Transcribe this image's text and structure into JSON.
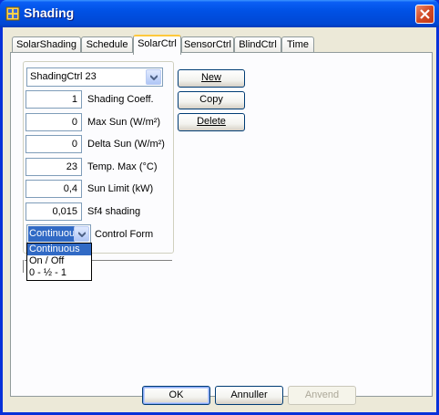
{
  "window": {
    "title": "Shading"
  },
  "tabs": [
    {
      "label": "SolarShading"
    },
    {
      "label": "Schedule"
    },
    {
      "label": "SolarCtrl"
    },
    {
      "label": "SensorCtrl"
    },
    {
      "label": "BlindCtrl"
    },
    {
      "label": "Time"
    }
  ],
  "active_tab": "SolarCtrl",
  "shading_ctrl_select": {
    "value": "ShadingCtrl 23"
  },
  "fields": [
    {
      "value": "1",
      "label": "Shading Coeff."
    },
    {
      "value": "0",
      "label": "Max Sun (W/m²)"
    },
    {
      "value": "0",
      "label": "Delta Sun (W/m²)"
    },
    {
      "value": "23",
      "label": "Temp. Max (°C)"
    },
    {
      "value": "0,4",
      "label": "Sun Limit (kW)"
    },
    {
      "value": "0,015",
      "label": "Sf4 shading"
    }
  ],
  "control_form": {
    "value": "Continuous",
    "label": "Control Form",
    "options": [
      "Continuous",
      "On / Off",
      "0 - ½ - 1"
    ],
    "selected_index": 0
  },
  "side_buttons": {
    "new": "New",
    "copy": "Copy",
    "delete": "Delete"
  },
  "footer_buttons": {
    "ok": "OK",
    "cancel": "Annuller",
    "apply": "Anvend"
  },
  "colors": {
    "titlebar": "#0054e3",
    "dialog_bg": "#ece9d8",
    "selection": "#316ac5",
    "tab_highlight": "#ffc83c"
  }
}
